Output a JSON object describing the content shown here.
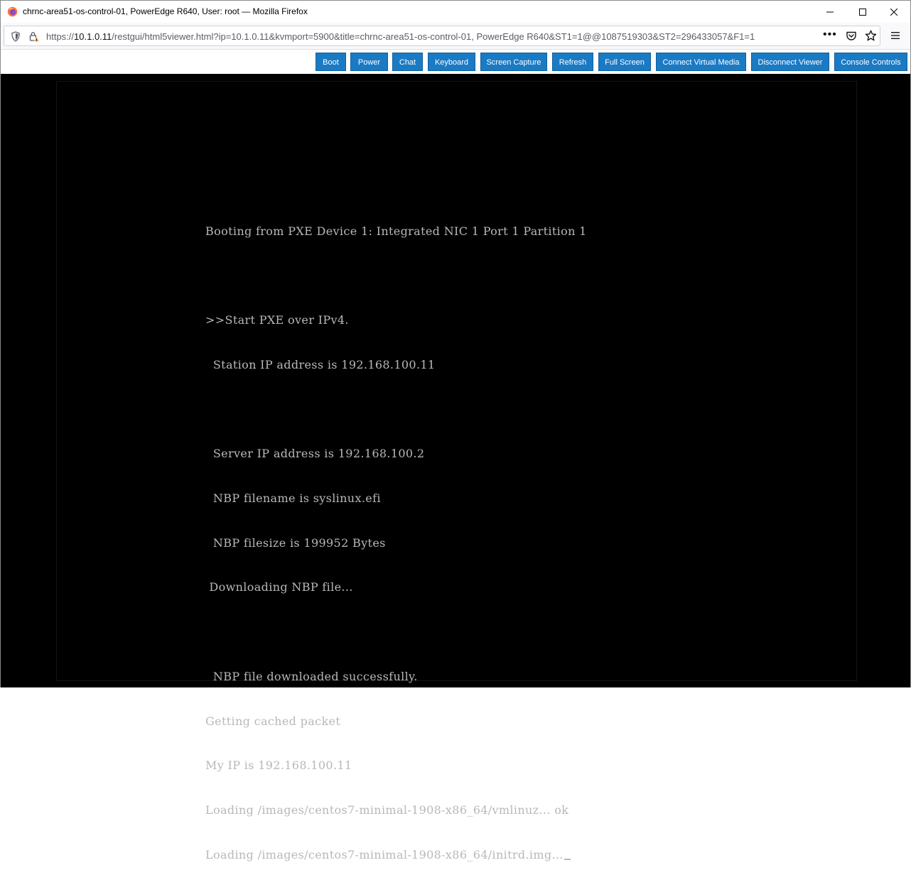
{
  "window": {
    "title": "chrnc-area51-os-control-01, PowerEdge R640, User: root — Mozilla Firefox"
  },
  "urlbar": {
    "prefix": "https://",
    "host": "10.1.0.11",
    "path": "/restgui/html5viewer.html?ip=10.1.0.11&kvmport=5900&title=chrnc-area51-os-control-01, PowerEdge R640&ST1=1@@1087519303&ST2=296433057&F1=1",
    "more_label": "•••"
  },
  "toolbar": {
    "boot": "Boot",
    "power": "Power",
    "chat": "Chat",
    "keyboard": "Keyboard",
    "screen_capture": "Screen Capture",
    "refresh": "Refresh",
    "full_screen": "Full Screen",
    "connect_virtual_media": "Connect Virtual Media",
    "disconnect_viewer": "Disconnect Viewer",
    "console_controls": "Console Controls"
  },
  "console": {
    "lines": [
      "Booting from PXE Device 1: Integrated NIC 1 Port 1 Partition 1",
      "",
      ">>Start PXE over IPv4.",
      "  Station IP address is 192.168.100.11",
      "",
      "  Server IP address is 192.168.100.2",
      "  NBP filename is syslinux.efi",
      "  NBP filesize is 199952 Bytes",
      " Downloading NBP file...",
      "",
      "  NBP file downloaded successfully.",
      "Getting cached packet",
      "My IP is 192.168.100.11",
      "Loading /images/centos7-minimal-1908-x86_64/vmlinuz... ok",
      "Loading /images/centos7-minimal-1908-x86_64/initrd.img..."
    ]
  },
  "colors": {
    "toolbar_button": "#1a7ac4",
    "console_background": "#000000",
    "console_text": "#b8b8b8",
    "firefox_orange": "#ff7139"
  },
  "icons": {
    "app": "firefox-logo-icon",
    "tracking": "shield-icon",
    "security": "lock-warning-icon",
    "pocket": "pocket-icon",
    "bookmark": "star-icon",
    "menu": "hamburger-menu-icon"
  }
}
